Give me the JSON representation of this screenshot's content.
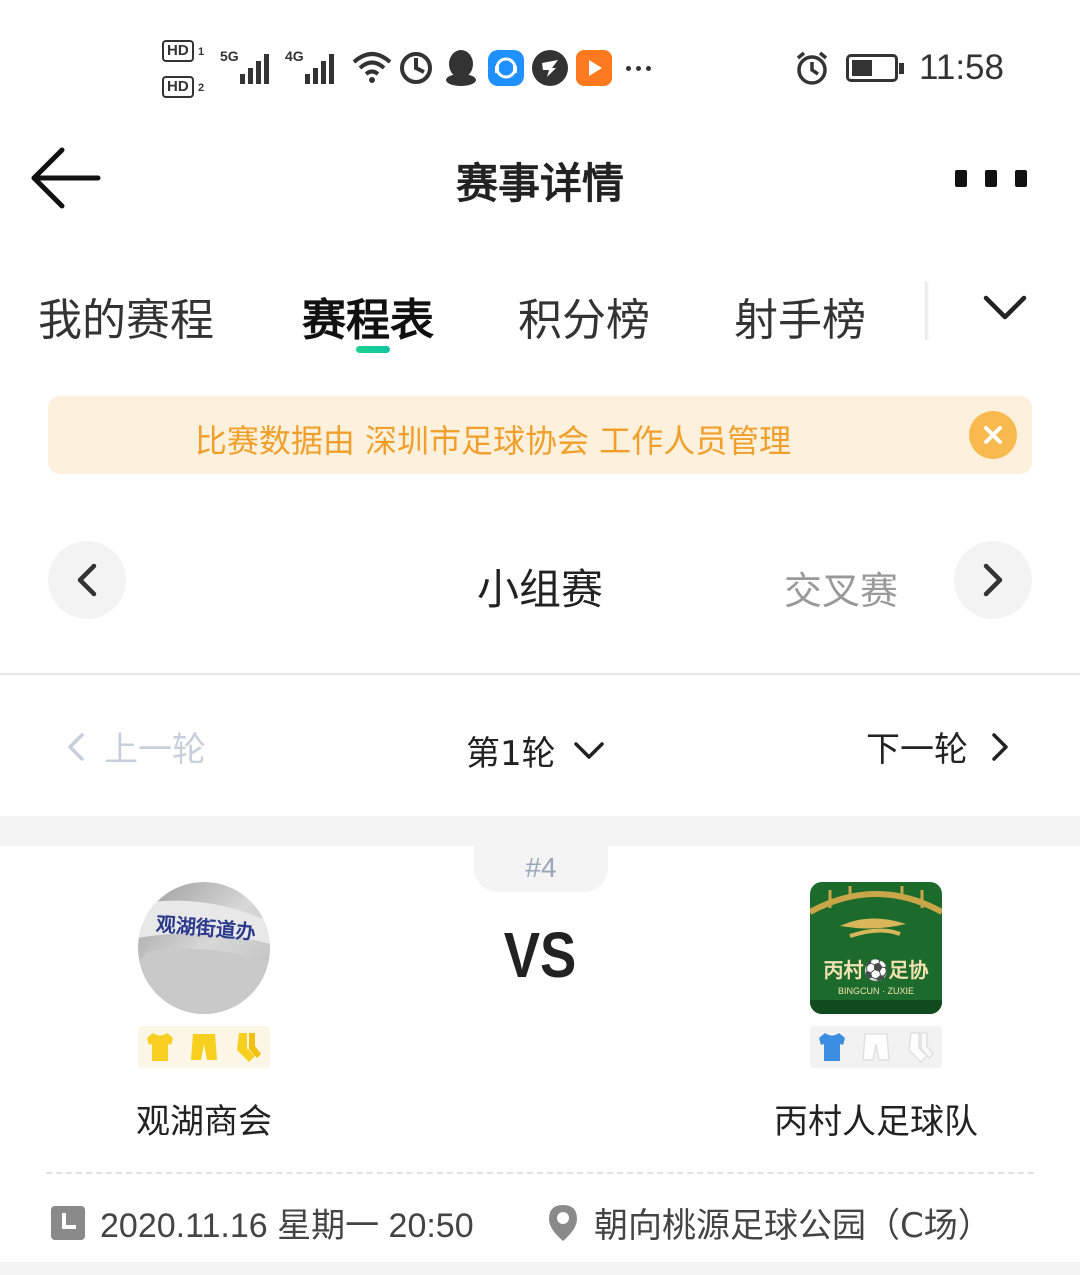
{
  "status_bar": {
    "hd1": "HD",
    "hd1_sub": "1",
    "hd2": "HD",
    "hd2_sub": "2",
    "net1": "5G",
    "net2": "4G",
    "time": "11:58",
    "icons": [
      "wifi-icon",
      "data-saver-icon",
      "qq-icon",
      "customer-service-app-icon",
      "dingtalk-icon",
      "video-app-icon",
      "more-notifications-icon",
      "alarm-icon",
      "battery-icon"
    ]
  },
  "header": {
    "title": "赛事详情"
  },
  "tabs": [
    {
      "label": "我的赛程",
      "active": false
    },
    {
      "label": "赛程表",
      "active": true
    },
    {
      "label": "积分榜",
      "active": false
    },
    {
      "label": "射手榜",
      "active": false
    }
  ],
  "notice": {
    "text": "比赛数据由 深圳市足球协会 工作人员管理"
  },
  "stage": {
    "current": "小组赛",
    "next": "交叉赛"
  },
  "round": {
    "prev_label": "上一轮",
    "current_label": "第1轮",
    "next_label": "下一轮"
  },
  "match": {
    "number": "#4",
    "vs": "VS",
    "home": {
      "name": "观湖商会",
      "logo_text": "观湖街道办",
      "kit_color": "#f7cf1e"
    },
    "away": {
      "name": "丙村人足球队",
      "logo_text": "丙村⚽足协",
      "logo_subtext": "BINGCUN · ZUXIE",
      "kit_color": "#3c8fe0"
    },
    "datetime": "2020.11.16 星期一 20:50",
    "venue": "朝向桃源足球公园（C场）"
  },
  "colors": {
    "accent_green": "#1dd18f",
    "notice_bg": "#fdf1de",
    "notice_text": "#f0a02a"
  }
}
